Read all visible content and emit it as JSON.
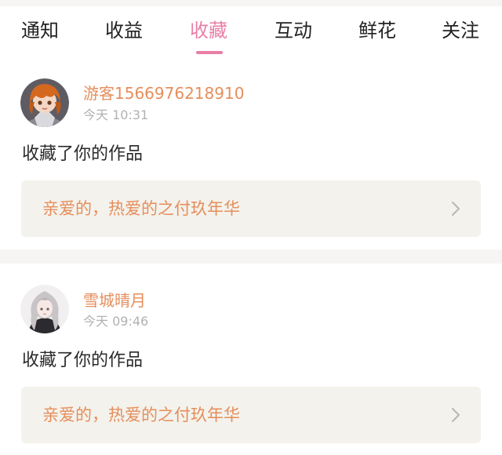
{
  "tabs": [
    {
      "label": "通知"
    },
    {
      "label": "收益"
    },
    {
      "label": "收藏"
    },
    {
      "label": "互动"
    },
    {
      "label": "鲜花"
    },
    {
      "label": "关注"
    }
  ],
  "active_tab": "收藏",
  "colors": {
    "accent_pink": "#e97fa6",
    "name_orange": "#e58e5c",
    "card_bg": "#f4f2ec",
    "timestamp_gray": "#b1b1b1"
  },
  "feed": [
    {
      "username": "游客1566976218910",
      "time": "今天 10:31",
      "action": "收藏了你的作品",
      "work_title": "亲爱的，热爱的之付玖年华",
      "avatar_icon": "anime-avatar-brown-hair"
    },
    {
      "username": "雪城晴月",
      "time": "今天 09:46",
      "action": "收藏了你的作品",
      "work_title": "亲爱的，热爱的之付玖年华",
      "avatar_icon": "anime-avatar-white-hair"
    }
  ]
}
